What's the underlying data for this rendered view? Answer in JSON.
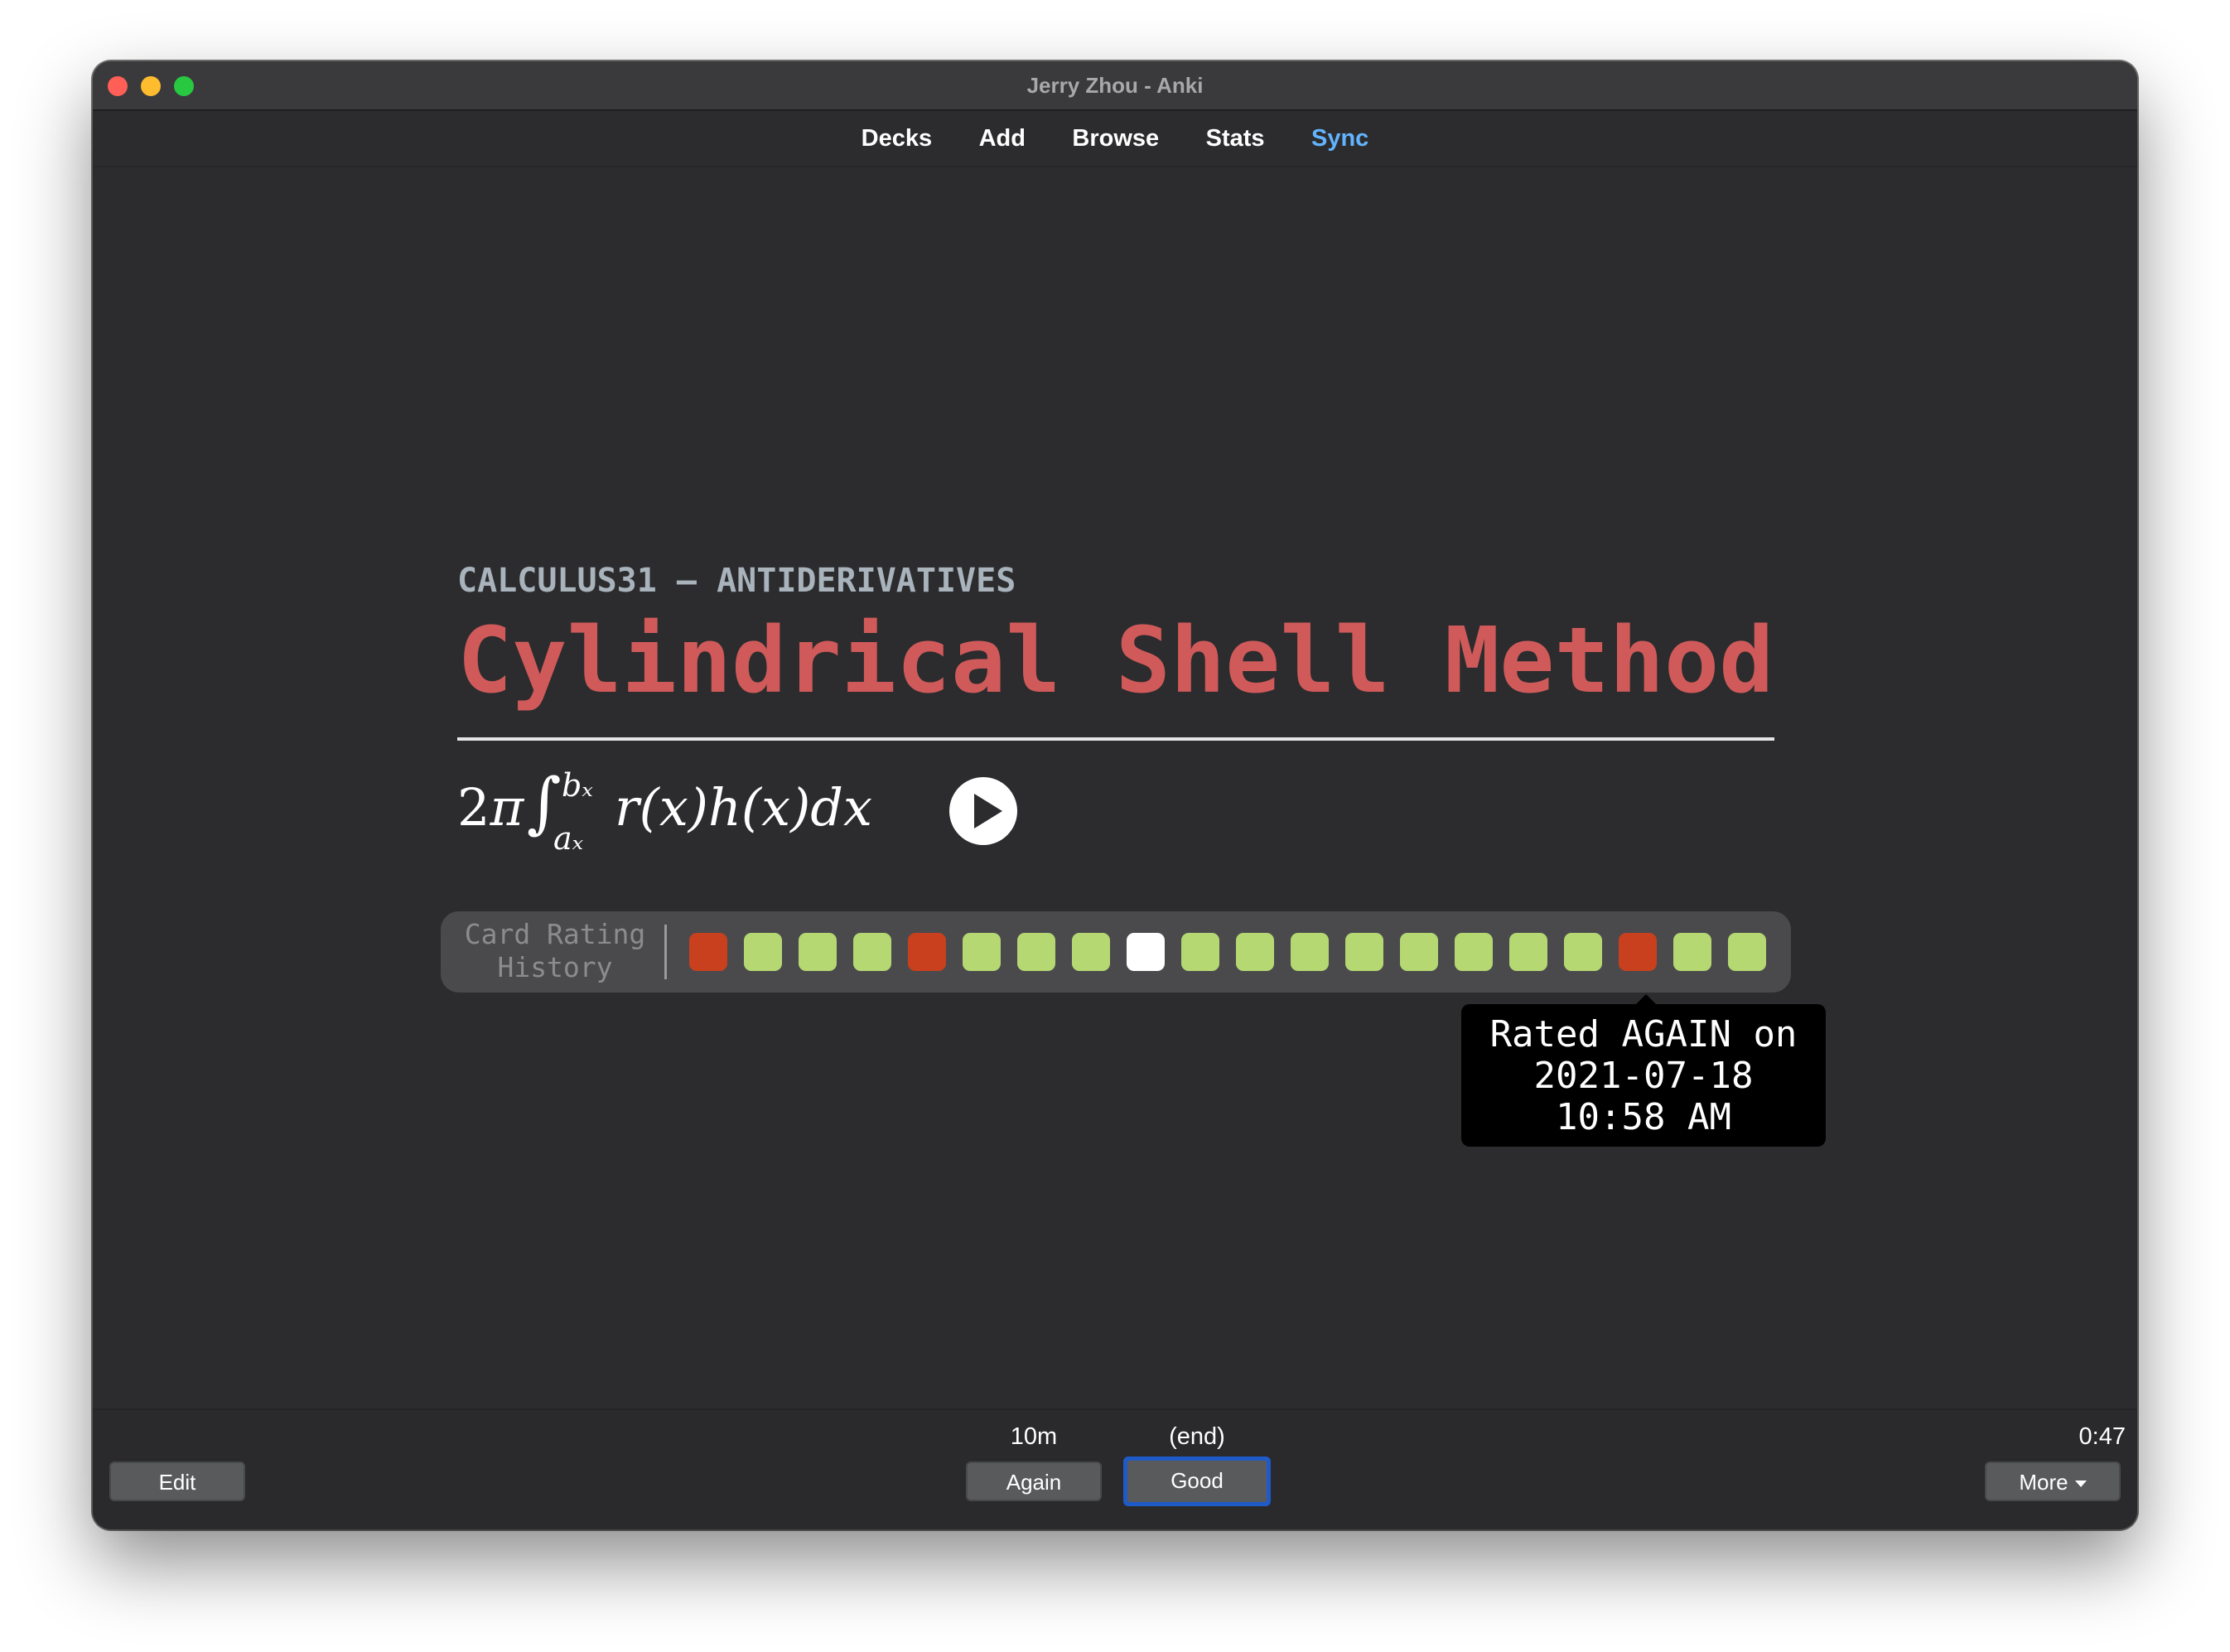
{
  "window": {
    "title": "Jerry Zhou - Anki"
  },
  "nav": {
    "items": [
      {
        "label": "Decks"
      },
      {
        "label": "Add"
      },
      {
        "label": "Browse"
      },
      {
        "label": "Stats"
      },
      {
        "label": "Sync"
      }
    ],
    "sync_color": "#62b4ff"
  },
  "card": {
    "deck": "CALCULUS31 – ANTIDERIVATIVES",
    "title": "Cylindrical Shell Method",
    "title_color": "#d05a5a",
    "formula": {
      "coefficient": "2",
      "pi": "π",
      "integral": "∫",
      "upper": "bₓ",
      "lower": "aₓ",
      "integrand": "r(x)h(x)dx"
    },
    "play_icon": "play-icon"
  },
  "rating_history": {
    "label_line1": "Card Rating",
    "label_line2": "History",
    "colors": {
      "again": "#c8401e",
      "good": "#b5d873",
      "current": "#ffffff"
    },
    "ratings": [
      "again",
      "good",
      "good",
      "good",
      "again",
      "good",
      "good",
      "good",
      "current",
      "good",
      "good",
      "good",
      "good",
      "good",
      "good",
      "good",
      "good",
      "again",
      "good",
      "good"
    ]
  },
  "tooltip": {
    "line1": "Rated AGAIN on",
    "line2": "2021-07-18",
    "line3": "10:58 AM"
  },
  "bottom": {
    "edit_label": "Edit",
    "again_label": "Again",
    "again_interval": "10m",
    "good_label": "Good",
    "good_interval": "(end)",
    "more_label": "More",
    "timer": "0:47"
  }
}
